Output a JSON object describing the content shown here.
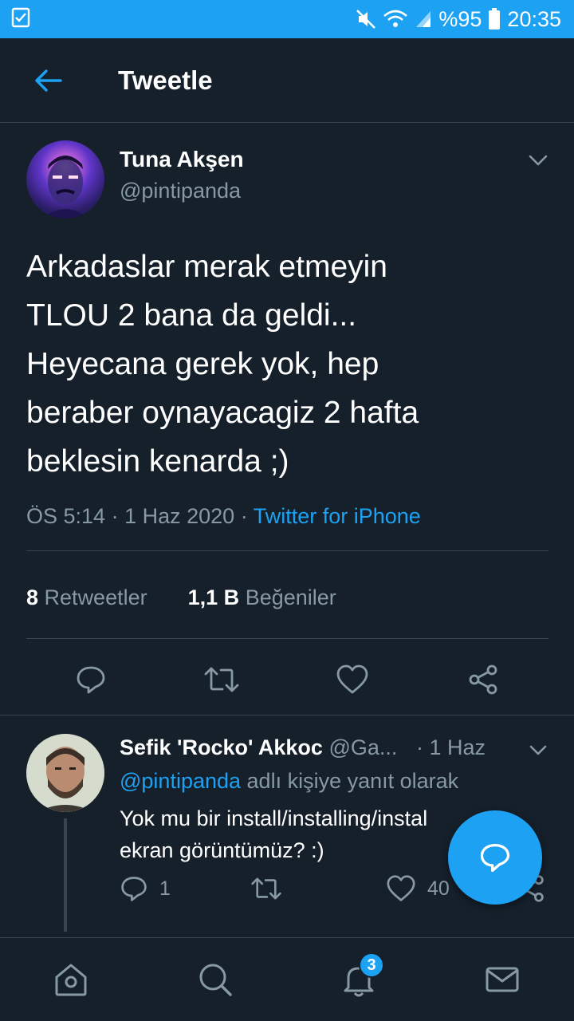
{
  "status_bar": {
    "battery": "%95",
    "time": "20:35"
  },
  "header": {
    "title": "Tweetle"
  },
  "tweet": {
    "author_name": "Tuna Akşen",
    "author_handle": "@pintipanda",
    "text_lines": [
      "Arkadaslar merak etmeyin",
      "TLOU 2 bana da geldi...",
      "Heyecana gerek yok, hep",
      "beraber oynayacagiz 2 hafta",
      "beklesin kenarda ;)"
    ],
    "time": "ÖS 5:14",
    "date": "1 Haz 2020",
    "source": "Twitter for iPhone",
    "separator": "·",
    "retweet_count": "8",
    "retweet_label": "Retweetler",
    "like_count": "1,1 B",
    "like_label": "Beğeniler"
  },
  "reply": {
    "author_name": "Sefik 'Rocko' Akkoc",
    "author_handle": "@Ga...",
    "time": "· 1 Haz",
    "replying_mention": "@pintipanda",
    "replying_suffix": " adlı kişiye yanıt olarak",
    "text_line1": "Yok mu bir install/installing/instal",
    "text_line2": "ekran görüntümüz? :)",
    "reply_count": "1",
    "like_count": "40"
  },
  "bottom_nav": {
    "notification_badge": "3"
  },
  "colors": {
    "background": "#15202b",
    "accent": "#1da1f2",
    "secondary_text": "#8899a6",
    "divider": "#38444d"
  },
  "icons": [
    "back-arrow-icon",
    "chevron-down-icon",
    "reply-icon",
    "retweet-icon",
    "like-icon",
    "share-icon",
    "compose-icon",
    "home-icon",
    "search-icon",
    "notifications-icon",
    "messages-icon",
    "mute-icon",
    "wifi-icon",
    "signal-icon",
    "battery-icon",
    "checklist-notification-icon"
  ]
}
